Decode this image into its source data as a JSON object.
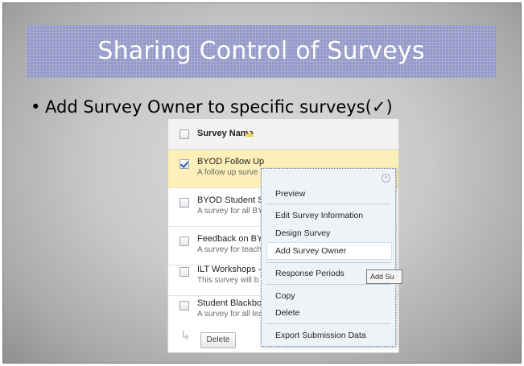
{
  "slide": {
    "title": "Sharing Control of Surveys",
    "bullet": "Add Survey Owner to specific surveys(✓)",
    "bullet_symbol": "•"
  },
  "table": {
    "header_label": "Survey Name",
    "rows": [
      {
        "name": "BYOD Follow Up",
        "desc": "A follow up surve",
        "checked": true
      },
      {
        "name": "BYOD Student Su",
        "desc": "A survey for all BY",
        "checked": false
      },
      {
        "name": "Feedback on BYC",
        "desc": "A survey for teach",
        "checked": false
      },
      {
        "name": "ILT Workshops - .",
        "desc": "This survey will b",
        "checked": false
      },
      {
        "name": "Student Blackboa",
        "desc": "A survey for all lea",
        "checked": false
      }
    ],
    "footer_arrow": "↳",
    "delete_label": "Delete"
  },
  "context_menu": {
    "close_glyph": "×",
    "items": [
      "Preview",
      "Edit Survey Information",
      "Design Survey",
      "Add Survey Owner",
      "Response Periods",
      "Copy",
      "Delete",
      "Export Submission Data"
    ],
    "highlighted_item": "Add Survey Owner"
  },
  "tooltip": {
    "text": "Add Su"
  },
  "colors": {
    "title_band": "#9499c8",
    "selected_row": "#fcefb8",
    "menu_background": "#eef3f8"
  }
}
